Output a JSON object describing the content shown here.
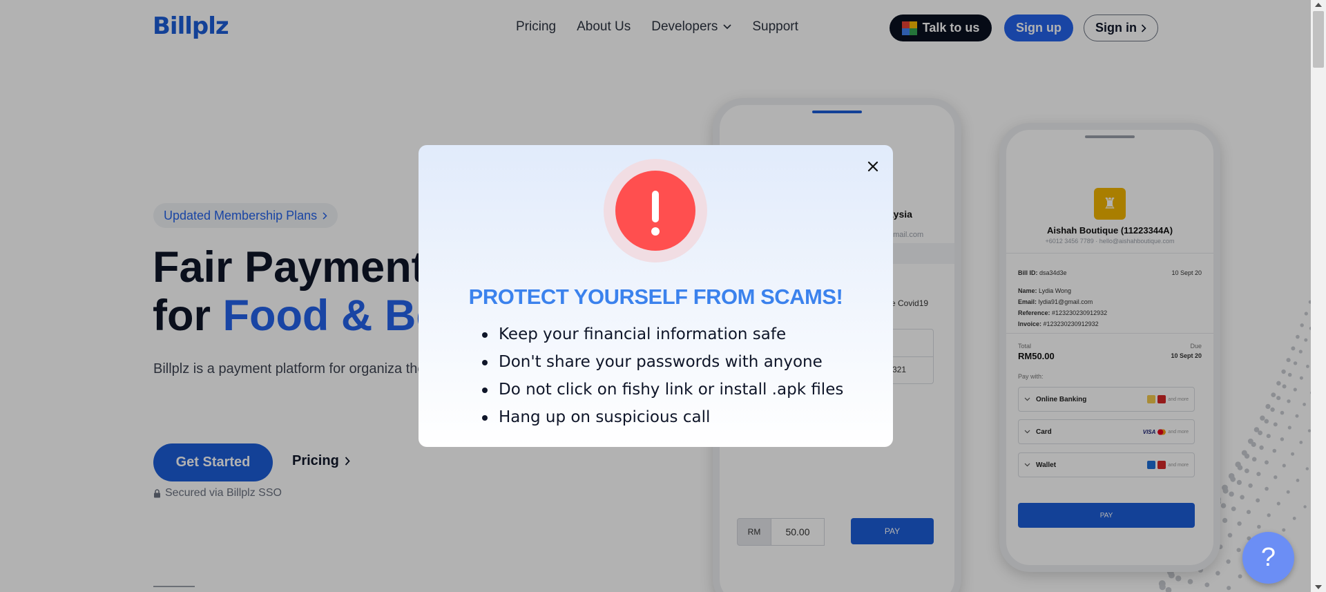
{
  "header": {
    "logo": "Billplz",
    "nav": [
      {
        "label": "Pricing"
      },
      {
        "label": "About Us"
      },
      {
        "label": "Developers"
      },
      {
        "label": "Support"
      }
    ],
    "talk_label": "Talk to us",
    "signup_label": "Sign up",
    "signin_label": "Sign in"
  },
  "hero": {
    "pill": "Updated Membership Plans",
    "title_line1": "Fair Payment",
    "title_line2_prefix": "for ",
    "title_line2_highlight": "Food & Bev",
    "description": "Billplz is a payment platform for organiza the lowest cost possible",
    "cta_primary": "Get Started",
    "cta_secondary": "Pricing",
    "secured": "Secured via Billplz SSO"
  },
  "phone1": {
    "title": "laysia",
    "email": "gmail.com",
    "note": "e Covid19",
    "number": "321",
    "currency": "RM",
    "amount": "50.00",
    "pay": "PAY"
  },
  "phone2": {
    "merchant": "Aishah Boutique (11223344A)",
    "contact": "+6012 3456 7789 · hello@aishahboutique.com",
    "bill_id_label": "Bill ID:",
    "bill_id": "dsa34d3e",
    "bill_date": "10 Sept 20",
    "name_label": "Name:",
    "name": "Lydia Wong",
    "email_label": "Email:",
    "email": "lydia91@gmail.com",
    "reference_label": "Reference:",
    "reference": "#123230230912932",
    "invoice_label": "Invoice:",
    "invoice": "#123230230912932",
    "total_label": "Total",
    "total": "RM50.00",
    "due_label": "Due",
    "due": "10 Sept 20",
    "pay_with": "Pay with:",
    "methods": [
      {
        "label": "Online Banking",
        "more": "and more"
      },
      {
        "label": "Card",
        "visa": "VISA",
        "more": "and more"
      },
      {
        "label": "Wallet",
        "more": "and more"
      }
    ],
    "pay": "PAY"
  },
  "modal": {
    "title": "PROTECT YOURSELF FROM SCAMS!",
    "tips": [
      "Keep your financial information safe",
      "Don't share your passwords with anyone",
      "Do not click on fishy link or install .apk files",
      "Hang up on suspicious call"
    ]
  },
  "help": {
    "icon": "?"
  },
  "colors": {
    "brand": "#1c5dd8",
    "accent": "#2563eb",
    "modal_title": "#3b82ed",
    "alert": "#ff4f4f",
    "help": "#6b8ef5"
  }
}
